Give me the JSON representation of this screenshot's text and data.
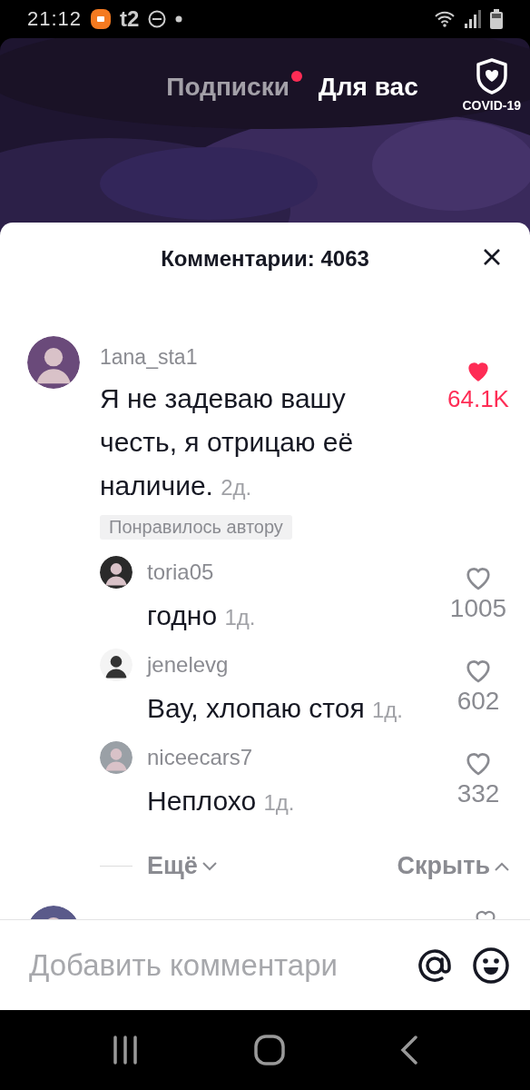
{
  "status_bar": {
    "time": "21:12",
    "carrier": "t2"
  },
  "feed_tabs": [
    {
      "label": "Подписки",
      "selected": false,
      "notification": true
    },
    {
      "label": "Для вас",
      "selected": true,
      "notification": false
    }
  ],
  "covid_button": {
    "label": "COVID-19"
  },
  "comments_sheet": {
    "title": "Комментарии: 4063",
    "comments": [
      {
        "username": "1ana_sta1",
        "text": "Я не задеваю вашу честь, я отрицаю её наличие.",
        "time": "2д.",
        "liked": true,
        "likes": "64.1K",
        "badge": "Понравилось автору",
        "replies": [
          {
            "username": "toria05",
            "text": "годно",
            "time": "1д.",
            "liked": false,
            "likes": "1005"
          },
          {
            "username": "jenelevg",
            "text": "Вау, хлопаю стоя",
            "time": "1д.",
            "liked": false,
            "likes": "602"
          },
          {
            "username": "niceecars7",
            "text": "Неплохо",
            "time": "1д.",
            "liked": false,
            "likes": "332"
          }
        ],
        "more_label": "Ещё",
        "hide_label": "Скрыть"
      }
    ]
  },
  "comment_input": {
    "placeholder": "Добавить комментари"
  }
}
